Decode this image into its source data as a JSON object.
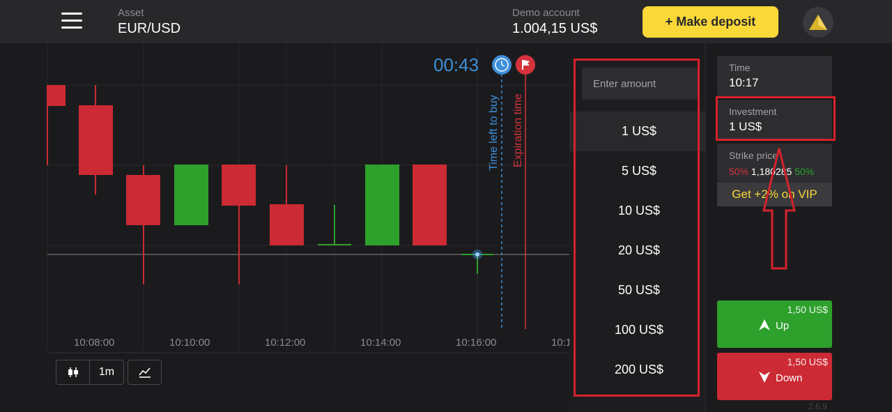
{
  "header": {
    "asset_label": "Asset",
    "asset_value": "EUR/USD",
    "demo_label": "Demo account",
    "demo_value": "1.004,15 US$",
    "deposit_label": "+ Make deposit",
    "avatar_icon": "triangle-avatar-icon"
  },
  "chart": {
    "timer": "00:43",
    "time_left_label": "Time left to buy",
    "expiration_label": "Expiration time",
    "x_ticks": [
      "10:08:00",
      "10:10:00",
      "10:12:00",
      "10:14:00",
      "10:16:00",
      "10:1"
    ]
  },
  "toolbar": {
    "interval": "1m",
    "candles_icon": "candlestick-icon",
    "indicator_icon": "indicator-icon"
  },
  "amount": {
    "placeholder": "Enter amount",
    "options": [
      "1 US$",
      "5 US$",
      "10 US$",
      "20 US$",
      "50 US$",
      "100 US$",
      "200 US$"
    ],
    "selected": "1 US$"
  },
  "trade": {
    "time_label": "Time",
    "time_value": "10:17",
    "investment_label": "Investment",
    "investment_value": "1 US$",
    "strike_label": "Strike price",
    "strike_left": "50%",
    "strike_value": "1,180285",
    "strike_right": "50%",
    "vip_label": "Get +2% on VIP",
    "up_payout": "1,50 US$",
    "up_label": "Up",
    "down_payout": "1,50 US$",
    "down_label": "Down",
    "version": "2.6.9"
  },
  "colors": {
    "accent_blue": "#3d8fd9",
    "bear_red": "#cc2a34",
    "bull_green": "#2ea02c",
    "deposit_yellow": "#f9d838",
    "highlight_red": "#d6222b"
  }
}
